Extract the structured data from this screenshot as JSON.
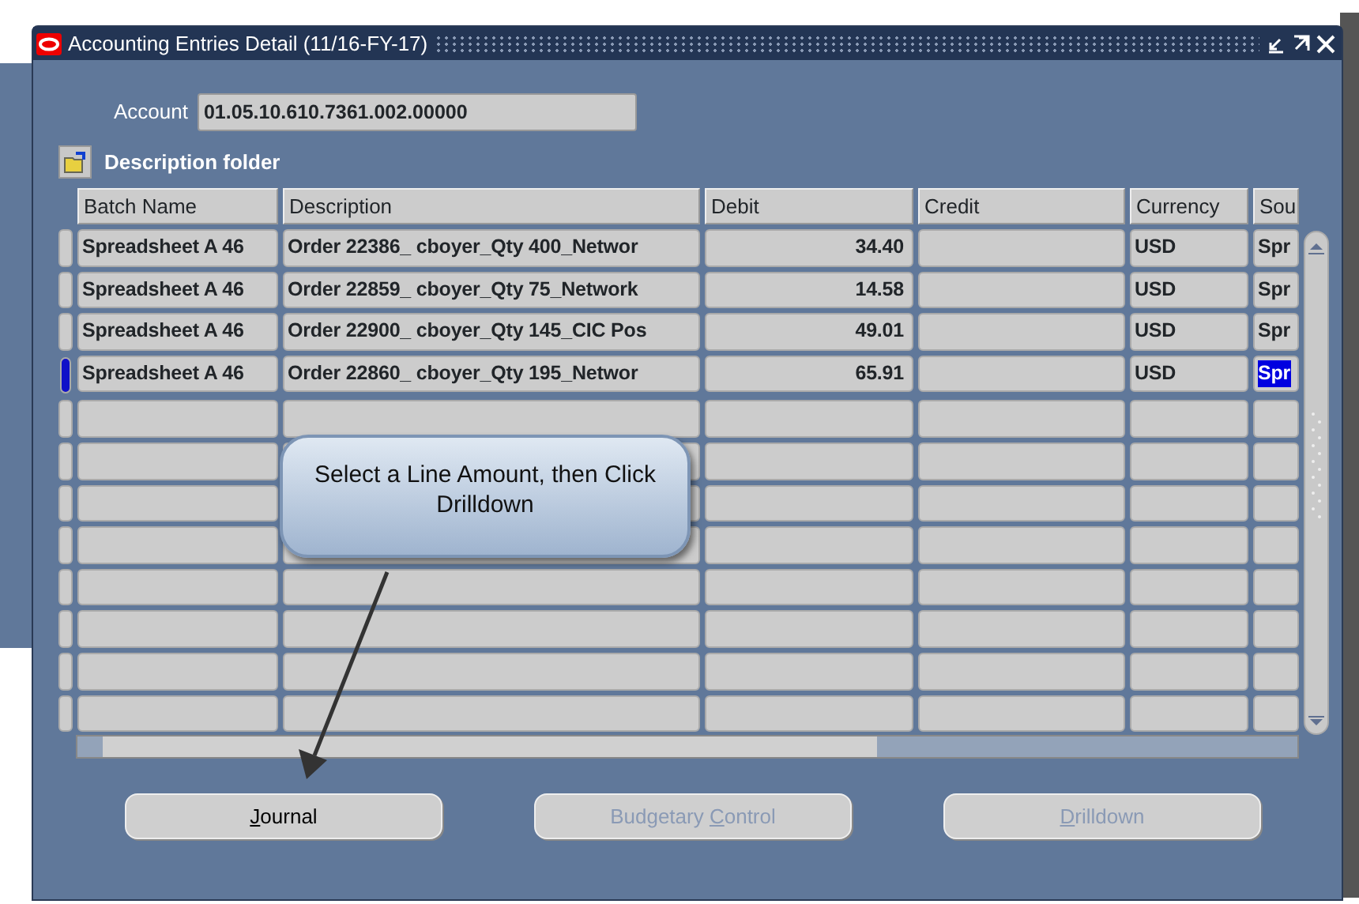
{
  "window": {
    "title": "Accounting Entries Detail (11/16-FY-17)"
  },
  "account": {
    "label": "Account",
    "value": "01.05.10.610.7361.002.00000"
  },
  "folder": {
    "label": "Description folder"
  },
  "table": {
    "columns": [
      "Batch Name",
      "Description",
      "Debit",
      "Credit",
      "Currency",
      "Sou"
    ],
    "rows": [
      {
        "selected": false,
        "cells": [
          "Spreadsheet A 46",
          "Order 22386_ cboyer_Qty 400_Networ",
          "34.40",
          "",
          "USD",
          "Spr"
        ]
      },
      {
        "selected": false,
        "cells": [
          "Spreadsheet A 46",
          "Order 22859_ cboyer_Qty 75_Network",
          "14.58",
          "",
          "USD",
          "Spr"
        ]
      },
      {
        "selected": false,
        "cells": [
          "Spreadsheet A 46",
          "Order 22900_ cboyer_Qty 145_CIC Pos",
          "49.01",
          "",
          "USD",
          "Spr"
        ]
      },
      {
        "selected": true,
        "cells": [
          "Spreadsheet A 46",
          "Order 22860_ cboyer_Qty 195_Networ",
          "65.91",
          "",
          "USD",
          "Spr"
        ]
      },
      {
        "selected": false
      },
      {
        "selected": false
      },
      {
        "selected": false
      },
      {
        "selected": false
      },
      {
        "selected": false
      },
      {
        "selected": false
      },
      {
        "selected": false
      },
      {
        "selected": false
      }
    ]
  },
  "callout": {
    "text": "Select a Line Amount, then Click Drilldown"
  },
  "buttons": [
    {
      "disabled": false,
      "label_parts": [
        {
          "text": "J",
          "underline": true
        },
        {
          "text": "ournal",
          "underline": false
        }
      ]
    },
    {
      "disabled": true,
      "label_parts": [
        {
          "text": "Budgetary ",
          "underline": false
        },
        {
          "text": "C",
          "underline": true
        },
        {
          "text": "ontrol",
          "underline": false
        }
      ]
    },
    {
      "disabled": true,
      "label_parts": [
        {
          "text": "D",
          "underline": true
        },
        {
          "text": "rilldown",
          "underline": false
        }
      ]
    }
  ]
}
